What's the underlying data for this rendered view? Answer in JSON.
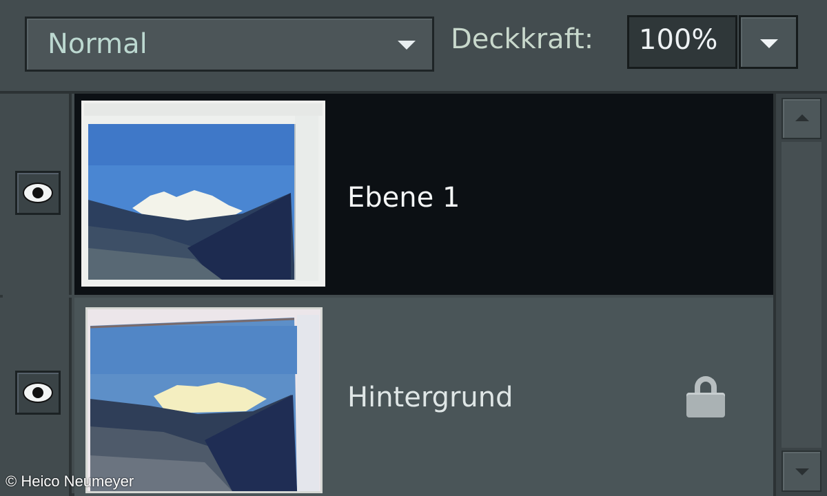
{
  "toolbar": {
    "blend_mode": "Normal",
    "opacity_label": "Deckkraft:",
    "opacity_value": "100%"
  },
  "layers": [
    {
      "name": "Ebene 1",
      "visible": true,
      "selected": true,
      "locked": false
    },
    {
      "name": "Hintergrund",
      "visible": true,
      "selected": false,
      "locked": true
    }
  ],
  "credit": "© Heico Neumeyer",
  "colors": {
    "panel_bg": "#424b4e",
    "selected_row": "#0c1014",
    "unselected_row": "#4a5558",
    "text": "#eef2f4"
  },
  "icons": {
    "visibility": "eye-icon",
    "lock": "lock-icon",
    "dropdown": "chevron-down-icon",
    "scroll_up": "arrow-up-icon",
    "scroll_down": "arrow-down-icon"
  }
}
